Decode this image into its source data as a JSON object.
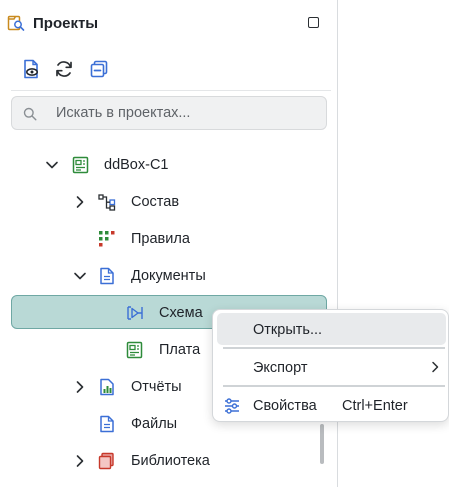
{
  "panel": {
    "title": "Проекты",
    "icons": {
      "app": "project-search-icon",
      "maximize": "maximize-icon"
    }
  },
  "toolbar": {
    "buttons": [
      "view-document-icon",
      "refresh-icon",
      "collapse-all-icon"
    ]
  },
  "search": {
    "placeholder": "Искать в проектах...",
    "value": "",
    "icon": "search-icon"
  },
  "tree": {
    "project": {
      "label": "ddBox-C1",
      "icon": "project-board-icon",
      "expanded": true
    },
    "items": [
      {
        "label": "Состав",
        "icon": "hierarchy-icon",
        "expandable": true,
        "expanded": false
      },
      {
        "label": "Правила",
        "icon": "rules-grid-icon",
        "expandable": false
      },
      {
        "label": "Документы",
        "icon": "document-icon",
        "expandable": true,
        "expanded": true
      },
      {
        "label": "Схема",
        "icon": "schematic-icon",
        "expandable": false,
        "selected": true
      },
      {
        "label": "Плата",
        "icon": "pcb-icon",
        "expandable": false
      },
      {
        "label": "Отчёты",
        "icon": "report-chart-icon",
        "expandable": true,
        "expanded": false
      },
      {
        "label": "Файлы",
        "icon": "file-icon",
        "expandable": false
      },
      {
        "label": "Библиотека",
        "icon": "library-icon",
        "expandable": true,
        "expanded": false
      }
    ]
  },
  "context_menu": {
    "open": "Открыть...",
    "export": "Экспорт",
    "properties": "Свойства",
    "properties_shortcut": "Ctrl+Enter"
  },
  "colors": {
    "accent_blue": "#3b6fd6",
    "green": "#2e8b3a",
    "selection_bg": "#b9d9d6",
    "selection_border": "#6fa8a4"
  }
}
